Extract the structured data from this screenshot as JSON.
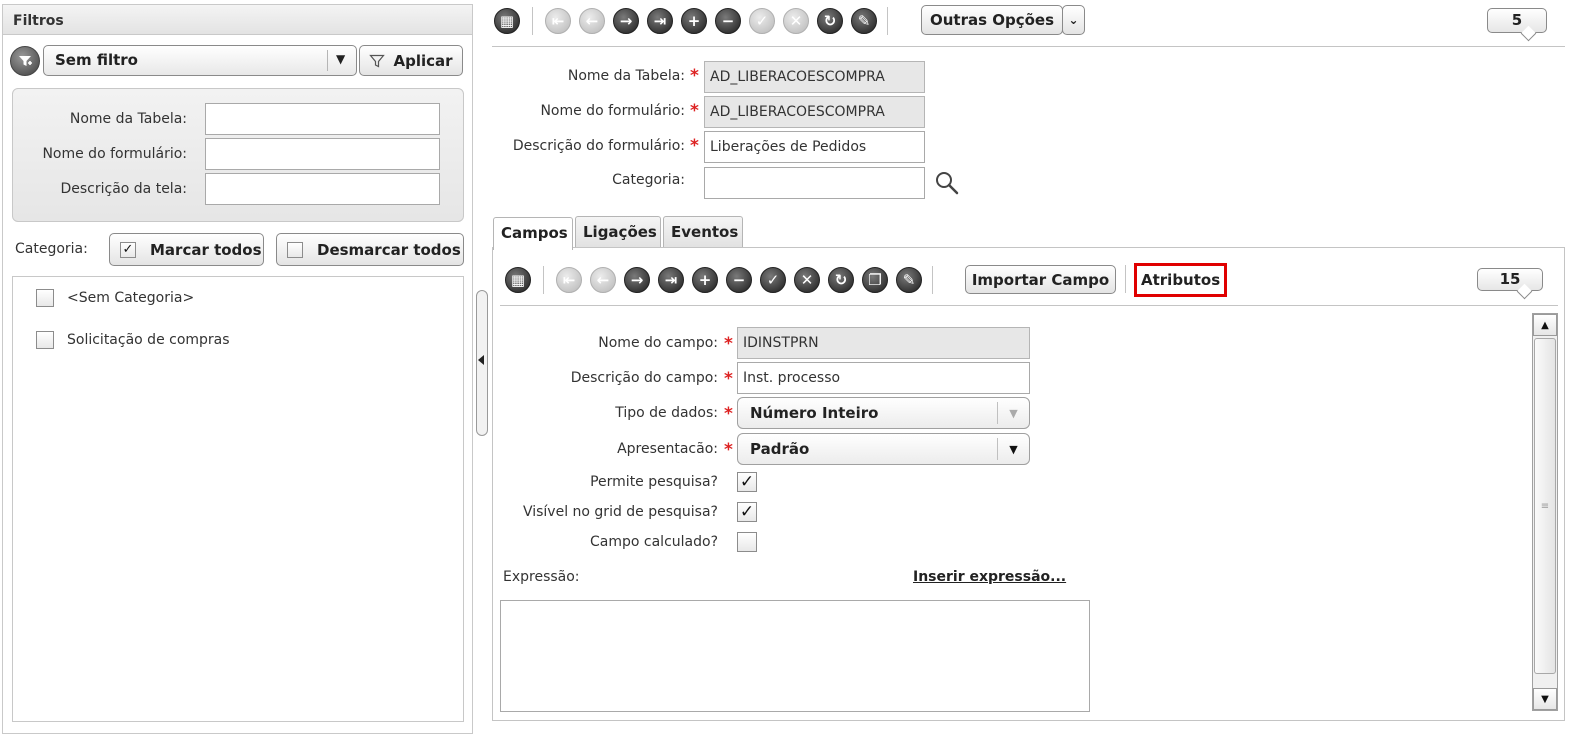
{
  "filters": {
    "title": "Filtros",
    "filter_select": "Sem filtro",
    "apply_label": "Aplicar",
    "fields": [
      {
        "label": "Nome da Tabela:",
        "value": ""
      },
      {
        "label": "Nome do formulário:",
        "value": ""
      },
      {
        "label": "Descrição da tela:",
        "value": ""
      }
    ],
    "category_label": "Categoria:",
    "mark_all": "Marcar todos",
    "unmark_all": "Desmarcar todos",
    "categories": [
      {
        "label": "<Sem Categoria>",
        "checked": false
      },
      {
        "label": "Solicitação de compras",
        "checked": false
      }
    ]
  },
  "main_toolbar": {
    "other_options": "Outras Opções",
    "record_count": "5"
  },
  "form": {
    "table_name_label": "Nome da Tabela:",
    "table_name": "AD_LIBERACOESCOMPRA",
    "form_name_label": "Nome do formulário:",
    "form_name": "AD_LIBERACOESCOMPRA",
    "form_desc_label": "Descrição do formulário:",
    "form_desc": "Liberações de Pedidos",
    "category_label": "Categoria:",
    "category": ""
  },
  "tabs": [
    {
      "label": "Campos",
      "active": true
    },
    {
      "label": "Ligações",
      "active": false
    },
    {
      "label": "Eventos",
      "active": false
    }
  ],
  "fields_toolbar": {
    "import_field": "Importar Campo",
    "attributes": "Atributos",
    "record_count": "15",
    "highlight_color": "#e00000"
  },
  "field_form": {
    "field_name_label": "Nome do campo:",
    "field_name": "IDINSTPRN",
    "field_desc_label": "Descrição do campo:",
    "field_desc": "Inst. processo",
    "data_type_label": "Tipo de dados:",
    "data_type": "Número Inteiro",
    "presentation_label": "Apresentacão:",
    "presentation": "Padrão",
    "searchable_label": "Permite pesquisa?",
    "searchable": true,
    "visible_grid_label": "Visível no grid de pesquisa?",
    "visible_grid": true,
    "calculated_label": "Campo calculado?",
    "calculated": false,
    "expression_label": "Expressão:",
    "insert_expression": "Inserir expressão...",
    "expression": ""
  }
}
